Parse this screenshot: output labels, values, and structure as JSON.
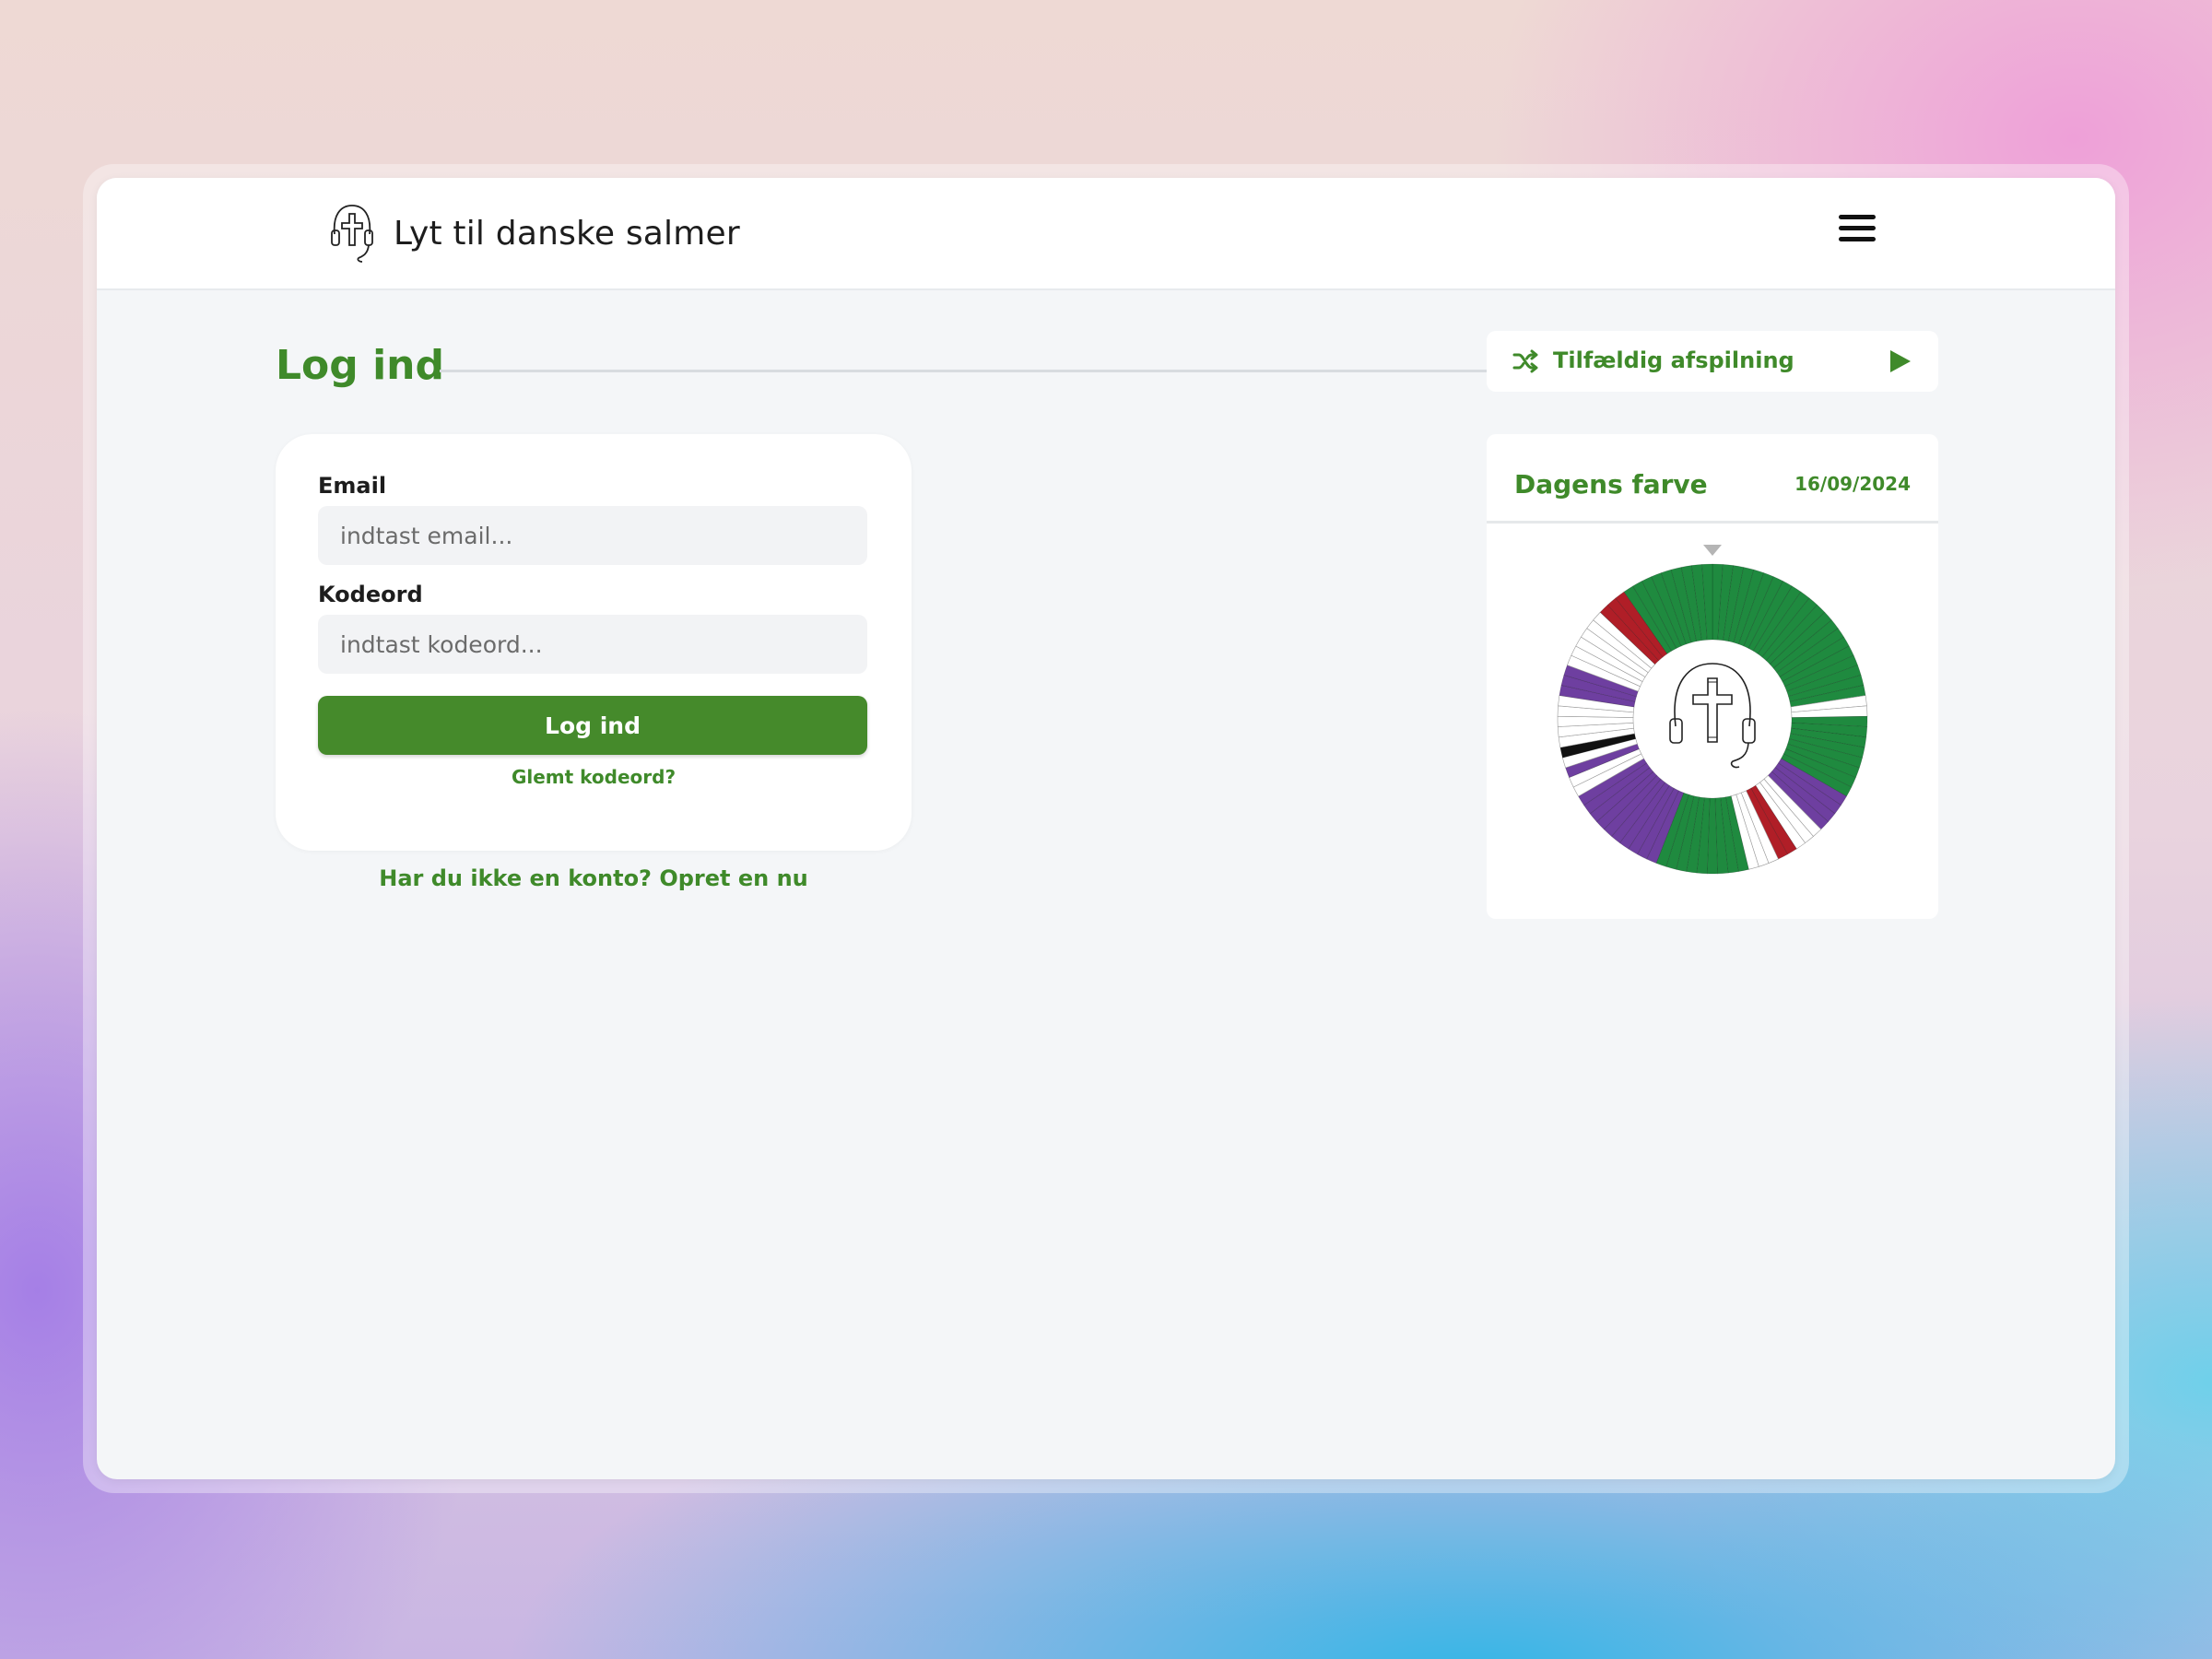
{
  "app": {
    "title": "Lyt til danske salmer",
    "logo_icon": "cross-headphones-logo",
    "menu_icon": "hamburger-menu-icon"
  },
  "login": {
    "heading": "Log ind",
    "email_label": "Email",
    "email_placeholder": "indtast email...",
    "email_value": "",
    "password_label": "Kodeord",
    "password_placeholder": "indtast kodeord...",
    "password_value": "",
    "submit_label": "Log ind",
    "forgot_label": "Glemt kodeord?",
    "signup_label": "Har du ikke en konto? Opret en nu"
  },
  "random_play": {
    "label": "Tilfældig afspilning",
    "shuffle_icon": "shuffle-icon",
    "play_icon": "play-icon"
  },
  "day_color": {
    "title": "Dagens farve",
    "date": "16/09/2024",
    "pointer_icon": "triangle-down-icon",
    "center_icon": "cross-headphones-logo"
  },
  "colors": {
    "accent": "#3f8a2a",
    "button": "#458a2b",
    "liturgical_green": "#1f8a3f",
    "liturgical_purple": "#6e3fa0",
    "liturgical_red": "#b01e27",
    "liturgical_white": "#ffffff",
    "liturgical_black": "#111111"
  }
}
